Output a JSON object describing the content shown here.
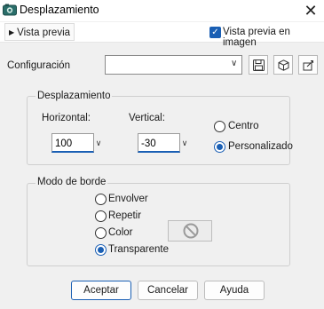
{
  "window": {
    "title": "Desplazamiento",
    "close_glyph": "✕"
  },
  "preview": {
    "toggle_label": "Vista previa",
    "checkbox_label": "Vista previa en imagen",
    "checkbox_checked": true
  },
  "config": {
    "label": "Configuración",
    "selected_value": "",
    "icons": [
      "save-icon",
      "cube-icon",
      "settings-manager-icon"
    ]
  },
  "displacement": {
    "legend": "Desplazamiento",
    "horizontal_label": "Horizontal:",
    "horizontal_value": "100",
    "vertical_label": "Vertical:",
    "vertical_value": "-30",
    "options": [
      "Centro",
      "Personalizado"
    ],
    "selected": "Personalizado"
  },
  "edge_mode": {
    "legend": "Modo de borde",
    "options": [
      "Envolver",
      "Repetir",
      "Color",
      "Transparente"
    ],
    "selected": "Transparente",
    "color_icon": "no-color-icon"
  },
  "buttons": {
    "ok": "Aceptar",
    "cancel": "Cancelar",
    "help": "Ayuda"
  },
  "colors": {
    "accent": "#1a5fb4",
    "window_bg": "#f0f0f0"
  }
}
